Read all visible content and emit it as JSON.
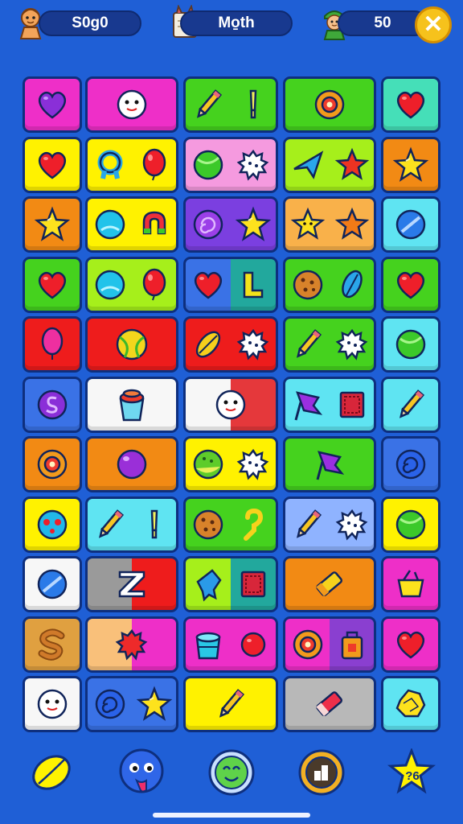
{
  "hud": {
    "left_score": "S0g0",
    "center_label": "Mo̱th",
    "right_value": "50",
    "close_symbol": "✕"
  },
  "bottom_badge": "?6",
  "colors": {
    "background": "#1f5fd6",
    "magenta": "#ee2fc8",
    "yellow": "#fff200",
    "orange": "#f28a14",
    "green": "#45d21e",
    "lime": "#a6ef1b",
    "cyan": "#5fe4f2",
    "red": "#ee1c1c",
    "purple": "#7b3fe0",
    "blue": "#3a72e6",
    "white": "#f7f7f7"
  },
  "grid": {
    "rows": [
      [
        {
          "bg": [
            "#ee2fc8"
          ],
          "icons": [
            "heart-purple"
          ]
        },
        {
          "bg": [
            "#ee2fc8"
          ],
          "icons": [
            "face"
          ]
        },
        {
          "bg": [
            "#45d21e"
          ],
          "icons": [
            "pencil",
            "marker"
          ]
        },
        {
          "bg": [
            "#45d21e"
          ],
          "icons": [
            "donut-orange"
          ]
        },
        {
          "bg": [
            "#45dfb8"
          ],
          "icons": [
            "heart-red"
          ]
        }
      ],
      [
        {
          "bg": [
            "#fff200"
          ],
          "icons": [
            "heart-red"
          ]
        },
        {
          "bg": [
            "#fff200"
          ],
          "icons": [
            "knot-cyan",
            "balloon-red"
          ]
        },
        {
          "bg": [
            "#f59adf"
          ],
          "icons": [
            "ball-green",
            "gear-white"
          ]
        },
        {
          "bg": [
            "#a6ef1b"
          ],
          "icons": [
            "plane-blue",
            "star-red"
          ]
        },
        {
          "bg": [
            "#f28a14"
          ],
          "icons": [
            "star-yellow"
          ]
        }
      ],
      [
        {
          "bg": [
            "#f28a14"
          ],
          "icons": [
            "star-yellow"
          ]
        },
        {
          "bg": [
            "#fff200"
          ],
          "icons": [
            "ball-cyan",
            "magnet"
          ]
        },
        {
          "bg": [
            "#7b3fe0"
          ],
          "icons": [
            "swirl-purple",
            "star-yellow"
          ]
        },
        {
          "bg": [
            "#f9b14a"
          ],
          "icons": [
            "star-face",
            "star-orange"
          ]
        },
        {
          "bg": [
            "#5fe4f2"
          ],
          "icons": [
            "pill-blue"
          ]
        }
      ],
      [
        {
          "bg": [
            "#45d21e"
          ],
          "icons": [
            "heart-red"
          ]
        },
        {
          "bg": [
            "#a6ef1b"
          ],
          "icons": [
            "ball-cyan",
            "balloon-red"
          ]
        },
        {
          "bg": [
            "#3a72e6",
            "#22a89d"
          ],
          "icons": [
            "heart-red",
            "letter-l"
          ]
        },
        {
          "bg": [
            "#45d21e"
          ],
          "icons": [
            "cookie",
            "leaf-blue"
          ]
        },
        {
          "bg": [
            "#45d21e"
          ],
          "icons": [
            "heart-red"
          ]
        }
      ],
      [
        {
          "bg": [
            "#ee1c1c"
          ],
          "icons": [
            "balloon-magenta"
          ]
        },
        {
          "bg": [
            "#ee1c1c"
          ],
          "icons": [
            "ball-tennis"
          ]
        },
        {
          "bg": [
            "#ee1c1c"
          ],
          "icons": [
            "leaf-yellow",
            "blob-white"
          ]
        },
        {
          "bg": [
            "#45d21e"
          ],
          "icons": [
            "pencil",
            "gear-white"
          ]
        },
        {
          "bg": [
            "#5fe4f2"
          ],
          "icons": [
            "ball-green"
          ]
        }
      ],
      [
        {
          "bg": [
            "#3a72e6"
          ],
          "icons": [
            "coin-purple"
          ]
        },
        {
          "bg": [
            "#f7f7f7"
          ],
          "icons": [
            "cup"
          ]
        },
        {
          "bg": [
            "#f7f7f7",
            "#e5383b"
          ],
          "icons": [
            "face"
          ]
        },
        {
          "bg": [
            "#5fe4f2"
          ],
          "icons": [
            "flag-purple",
            "box-red"
          ]
        },
        {
          "bg": [
            "#5fe4f2"
          ],
          "icons": [
            "pencil"
          ]
        }
      ],
      [
        {
          "bg": [
            "#f28a14"
          ],
          "icons": [
            "donut-orange"
          ]
        },
        {
          "bg": [
            "#f28a14"
          ],
          "icons": [
            "ball-purple"
          ]
        },
        {
          "bg": [
            "#fff200"
          ],
          "icons": [
            "cookie-green",
            "blob-white"
          ]
        },
        {
          "bg": [
            "#45d21e"
          ],
          "icons": [
            "flag-purple"
          ]
        },
        {
          "bg": [
            "#3a72e6"
          ],
          "icons": [
            "swirl-blue"
          ]
        }
      ],
      [
        {
          "bg": [
            "#fff200"
          ],
          "icons": [
            "ball-cyan-red"
          ]
        },
        {
          "bg": [
            "#5fe4f2"
          ],
          "icons": [
            "pencil",
            "marker"
          ]
        },
        {
          "bg": [
            "#45d21e"
          ],
          "icons": [
            "cookie",
            "hook-yellow"
          ]
        },
        {
          "bg": [
            "#8fb3ff"
          ],
          "icons": [
            "pencil",
            "gear-white"
          ]
        },
        {
          "bg": [
            "#fff200"
          ],
          "icons": [
            "ball-green"
          ]
        }
      ],
      [
        {
          "bg": [
            "#f7f7f7"
          ],
          "icons": [
            "pill-blue"
          ]
        },
        {
          "bg": [
            "#9a9a9a",
            "#ee1c1c"
          ],
          "icons": [
            "letter-z"
          ]
        },
        {
          "bg": [
            "#a6ef1b",
            "#22a89d"
          ],
          "icons": [
            "jelly-blue",
            "box-red"
          ]
        },
        {
          "bg": [
            "#f28a14"
          ],
          "icons": [
            "eraser-yellow"
          ]
        },
        {
          "bg": [
            "#ee2fc8"
          ],
          "icons": [
            "basket-yellow"
          ]
        }
      ],
      [
        {
          "bg": [
            "#e0a040"
          ],
          "icons": [
            "letter-s"
          ]
        },
        {
          "bg": [
            "#f9c07a",
            "#ee2fc8"
          ],
          "icons": [
            "gear-red"
          ]
        },
        {
          "bg": [
            "#ee2fc8"
          ],
          "icons": [
            "cup-cyan",
            "ball-red"
          ]
        },
        {
          "bg": [
            "#ee2fc8",
            "#8a3fd0"
          ],
          "icons": [
            "donut-orange",
            "bag-orange"
          ]
        },
        {
          "bg": [
            "#ee2fc8"
          ],
          "icons": [
            "heart-red"
          ]
        }
      ],
      [
        {
          "bg": [
            "#f7f7f7"
          ],
          "icons": [
            "face"
          ]
        },
        {
          "bg": [
            "#3a72e6"
          ],
          "icons": [
            "swirl-blue",
            "star-yellow"
          ]
        },
        {
          "bg": [
            "#fff200"
          ],
          "icons": [
            "pencil"
          ]
        },
        {
          "bg": [
            "#b8b8b8"
          ],
          "icons": [
            "eraser-red"
          ]
        },
        {
          "bg": [
            "#5fe4f2"
          ],
          "icons": [
            "crumple-yellow"
          ]
        }
      ]
    ]
  },
  "bottom_buttons": [
    "leaf-button",
    "blue-face-button",
    "green-face-button",
    "box-button",
    "star-button"
  ]
}
